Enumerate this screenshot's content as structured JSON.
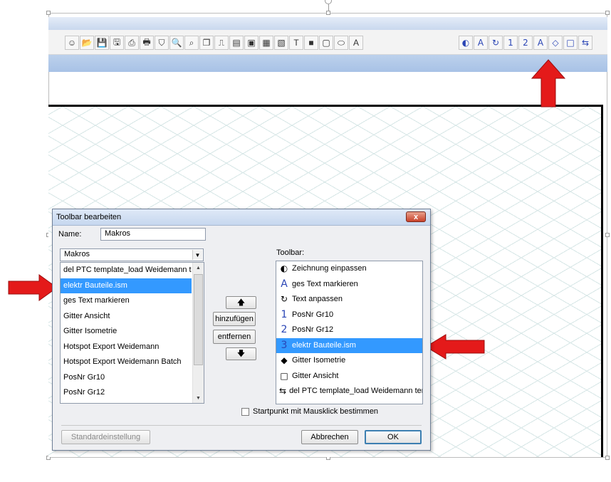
{
  "toolbar": {
    "left_icons": [
      "smiley-icon",
      "open-folder-icon",
      "save-icon",
      "save-all-icon",
      "print-preview-icon",
      "print-icon",
      "binoculars-icon",
      "zoom-icon",
      "zoom-window-icon",
      "layers-icon",
      "measure-icon",
      "page-icon",
      "stamp-icon",
      "image-icon",
      "picture-icon",
      "text-color-icon",
      "red-square-icon",
      "frame-icon",
      "ellipse-icon",
      "underline-a-icon"
    ],
    "right_buttons": [
      {
        "glyph": "◐",
        "icon": "fit-drawing-icon"
      },
      {
        "glyph": "A",
        "icon": "text-a-icon"
      },
      {
        "glyph": "↻",
        "icon": "refresh-text-icon"
      },
      {
        "glyph": "1",
        "icon": "number-one-icon"
      },
      {
        "glyph": "2",
        "icon": "number-two-icon"
      },
      {
        "glyph": "A",
        "icon": "text-a-icon"
      },
      {
        "glyph": "◇",
        "icon": "diamond-icon"
      },
      {
        "glyph": "□",
        "icon": "square-icon"
      },
      {
        "glyph": "⇆",
        "icon": "swap-icon"
      }
    ]
  },
  "dialog": {
    "title": "Toolbar bearbeiten",
    "close_label": "x",
    "name_label": "Name:",
    "name_value": "Makros",
    "category_value": "Makros",
    "available_items": [
      "del PTC template_load Weidemann templ...",
      "elektr Bauteile.ism",
      "ges Text markieren",
      "Gitter Ansicht",
      "Gitter Isometrie",
      "Hotspot Export Weidemann",
      "Hotspot Export Weidemann Batch",
      "PosNr Gr10",
      "PosNr Gr12"
    ],
    "available_selected_index": 1,
    "toolbar_label": "Toolbar:",
    "toolbar_items": [
      {
        "icon": "fit-drawing-icon",
        "glyph": "◐",
        "label": "Zeichnung einpassen"
      },
      {
        "icon": "text-a-icon",
        "glyph": "A",
        "label": "ges Text markieren"
      },
      {
        "icon": "refresh-text-icon",
        "glyph": "↻",
        "label": "Text anpassen"
      },
      {
        "icon": "number-one-icon",
        "glyph": "1",
        "label": "PosNr Gr10"
      },
      {
        "icon": "number-two-icon",
        "glyph": "2",
        "label": "PosNr Gr12"
      },
      {
        "icon": "number-three-icon",
        "glyph": "3",
        "label": "elektr Bauteile.ism"
      },
      {
        "icon": "diamond-icon",
        "glyph": "◆",
        "label": "Gitter Isometrie"
      },
      {
        "icon": "square-icon",
        "glyph": "□",
        "label": "Gitter Ansicht"
      },
      {
        "icon": "swap-icon",
        "glyph": "⇆",
        "label": "del PTC template_load Weidemann templat"
      }
    ],
    "toolbar_selected_index": 5,
    "move_up_label": "🡅",
    "add_label": "hinzufügen",
    "remove_label": "entfernen",
    "move_down_label": "🡇",
    "checkbox_label": "Startpunkt mit Mausklick bestimmen",
    "checkbox_checked": false,
    "default_button": "Standardeinstellung",
    "cancel_button": "Abbrechen",
    "ok_button": "OK"
  },
  "colors": {
    "arrow": "#e41a1a",
    "selection": "#3399ff",
    "icon_blue": "#2a45b5"
  }
}
